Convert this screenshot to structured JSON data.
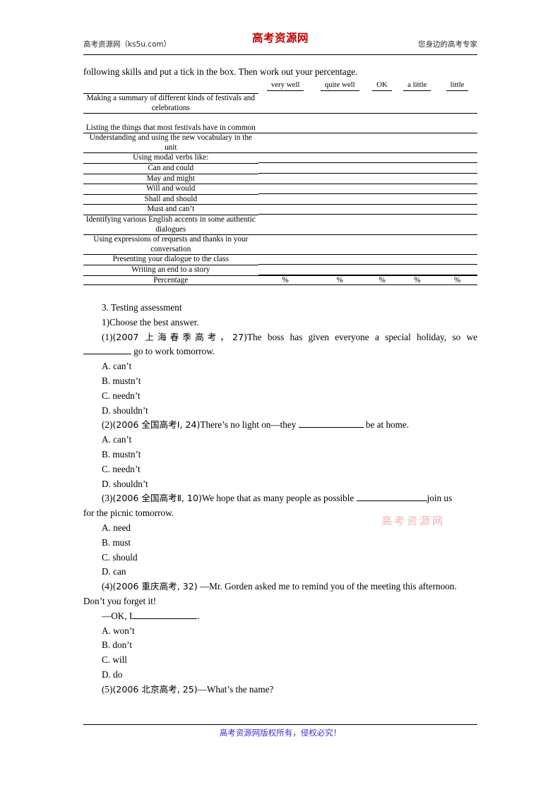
{
  "header": {
    "left": "高考资源网（ks5u.com）",
    "logo": "高考资源网",
    "right": "您身边的高考专家"
  },
  "footer": {
    "text": "高考资源网版权所有，侵权必究！"
  },
  "watermark": {
    "text": "高考资源网"
  },
  "lead": {
    "line": "following skills and put a tick in the box. Then work out your percentage."
  },
  "table": {
    "columns": [
      "very well",
      "quite well",
      "OK",
      "a little",
      "little"
    ],
    "rows": [
      {
        "label": "Making a summary of different kinds of festivals and celebrations",
        "tall": true
      },
      {
        "label": "Listing the things that most festivals have in common",
        "tall": true
      },
      {
        "label": "Understanding and using the new vocabulary in the unit",
        "tall": true
      },
      {
        "label": "Using modal verbs like:",
        "tall": false
      },
      {
        "label": "Can and could",
        "tall": false
      },
      {
        "label": "May and might",
        "tall": false
      },
      {
        "label": "Will and would",
        "tall": false
      },
      {
        "label": "Shall and should",
        "tall": false
      },
      {
        "label": "Must and can’t",
        "tall": false
      },
      {
        "label": "Identifying various English accents in some authentic dialogues",
        "tall": true
      },
      {
        "label": "Using expressions of requests and thanks in your conversation",
        "tall": true
      },
      {
        "label": "Presenting your dialogue to the class",
        "tall": false
      },
      {
        "label": "Writing an end to a story",
        "tall": false
      }
    ],
    "percentage_label": "Percentage",
    "percentage_values": [
      "%",
      "%",
      "%",
      "%",
      "%"
    ]
  },
  "section": {
    "heading": "3. Testing assessment",
    "subheading": "1)Choose the best answer."
  },
  "questions": [
    {
      "number": "(1)",
      "source": "(2007 上海春季高考，27)",
      "stem_part1": "The boss has given everyone a special holiday, so we",
      "stem_part2": "go to work tomorrow.",
      "options": [
        "A. can’t",
        "B. mustn’t",
        "C. needn’t",
        "D. shouldn’t"
      ]
    },
    {
      "number": "(2)",
      "source": "(2006 全国高考Ⅰ, 24)",
      "stem_part1": "There’s no light on—they",
      "stem_part2": "be at home.",
      "options": [
        "A. can’t",
        "B. mustn’t",
        "C. needn’t",
        "D. shouldn’t"
      ]
    },
    {
      "number": "(3)",
      "source": "(2006 全国高考Ⅱ, 10)",
      "stem_part1": "We hope that as many people as possible",
      "stem_part2": "join us",
      "stem_part3": "for the picnic tomorrow.",
      "options": [
        "A. need",
        "B. must",
        "C. should",
        "D. can"
      ]
    },
    {
      "number": "(4)",
      "source": "(2006 重庆高考, 32)",
      "stem_part1": "—Mr. Gorden asked me to remind you of the meeting this afternoon.",
      "stem_part2": "Don’t you forget it!",
      "stem_part3": "—OK, I",
      "stem_part4": ".",
      "options": [
        "A. won’t",
        "B. don’t",
        "C. will",
        "D. do"
      ]
    },
    {
      "number": "(5)",
      "source": "(2006 北京高考, 25)",
      "stem_part1": "—What’s the name?",
      "options": []
    }
  ]
}
